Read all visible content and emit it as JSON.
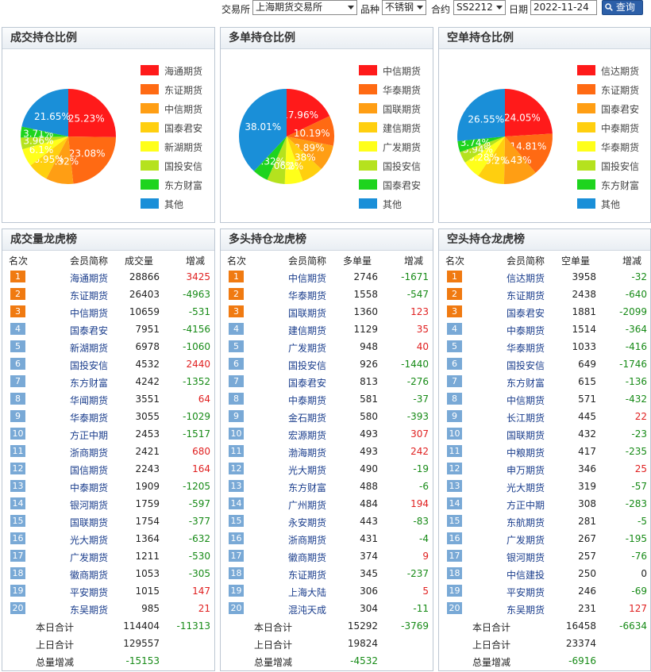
{
  "query": {
    "exchange_label": "交易所",
    "exchange_value": "上海期货交易所",
    "variety_label": "品种",
    "variety_value": "不锈钢",
    "contract_label": "合约",
    "contract_value": "SS2212",
    "date_label": "日期",
    "date_value": "2022-11-24",
    "search_label": "查询"
  },
  "pie_panels": [
    {
      "title": "成交持仓比例",
      "chart_data": {
        "type": "pie",
        "slices": [
          {
            "label": "海通期货",
            "value": 25.23,
            "color": "#ff1a1a"
          },
          {
            "label": "东证期货",
            "value": 23.08,
            "color": "#ff6a13"
          },
          {
            "label": "中信期货",
            "value": 9.32,
            "color": "#ff9e14"
          },
          {
            "label": "国泰君安",
            "value": 6.95,
            "color": "#ffcf0f"
          },
          {
            "label": "新湖期货",
            "value": 6.1,
            "color": "#ffff1a"
          },
          {
            "label": "国投安信",
            "value": 3.96,
            "color": "#b5e21e"
          },
          {
            "label": "东方财富",
            "value": 3.71,
            "color": "#1ed41e"
          },
          {
            "label": "其他",
            "value": 21.65,
            "color": "#1a8fd8"
          }
        ]
      }
    },
    {
      "title": "多单持仓比例",
      "chart_data": {
        "type": "pie",
        "slices": [
          {
            "label": "中信期货",
            "value": 17.96,
            "color": "#ff1a1a"
          },
          {
            "label": "华泰期货",
            "value": 10.19,
            "color": "#ff6a13"
          },
          {
            "label": "国联期货",
            "value": 8.89,
            "color": "#ff9e14"
          },
          {
            "label": "建信期货",
            "value": 7.38,
            "color": "#ffcf0f"
          },
          {
            "label": "广发期货",
            "value": 6.2,
            "color": "#ffff1a"
          },
          {
            "label": "国投安信",
            "value": 6.06,
            "color": "#b5e21e"
          },
          {
            "label": "国泰君安",
            "value": 5.32,
            "color": "#1ed41e"
          },
          {
            "label": "其他",
            "value": 38.01,
            "color": "#1a8fd8"
          }
        ]
      }
    },
    {
      "title": "空单持仓比例",
      "chart_data": {
        "type": "pie",
        "slices": [
          {
            "label": "信达期货",
            "value": 24.05,
            "color": "#ff1a1a"
          },
          {
            "label": "东证期货",
            "value": 14.81,
            "color": "#ff6a13"
          },
          {
            "label": "国泰君安",
            "value": 11.43,
            "color": "#ff9e14"
          },
          {
            "label": "中泰期货",
            "value": 9.2,
            "color": "#ffcf0f"
          },
          {
            "label": "华泰期货",
            "value": 6.28,
            "color": "#ffff1a"
          },
          {
            "label": "国投安信",
            "value": 3.94,
            "color": "#b5e21e"
          },
          {
            "label": "东方财富",
            "value": 3.74,
            "color": "#1ed41e"
          },
          {
            "label": "其他",
            "value": 26.55,
            "color": "#1a8fd8"
          }
        ]
      }
    }
  ],
  "tables": [
    {
      "title": "成交量龙虎榜",
      "headers": [
        "名次",
        "会员简称",
        "成交量",
        "增减"
      ],
      "rows": [
        [
          "1",
          "海通期货",
          "28866",
          "3425"
        ],
        [
          "2",
          "东证期货",
          "26403",
          "-4963"
        ],
        [
          "3",
          "中信期货",
          "10659",
          "-531"
        ],
        [
          "4",
          "国泰君安",
          "7951",
          "-4156"
        ],
        [
          "5",
          "新湖期货",
          "6978",
          "-1060"
        ],
        [
          "6",
          "国投安信",
          "4532",
          "2440"
        ],
        [
          "7",
          "东方财富",
          "4242",
          "-1352"
        ],
        [
          "8",
          "华闻期货",
          "3551",
          "64"
        ],
        [
          "9",
          "华泰期货",
          "3055",
          "-1029"
        ],
        [
          "10",
          "方正中期",
          "2453",
          "-1517"
        ],
        [
          "11",
          "浙商期货",
          "2421",
          "680"
        ],
        [
          "12",
          "国信期货",
          "2243",
          "164"
        ],
        [
          "13",
          "中泰期货",
          "1909",
          "-1205"
        ],
        [
          "14",
          "银河期货",
          "1759",
          "-597"
        ],
        [
          "15",
          "国联期货",
          "1754",
          "-377"
        ],
        [
          "16",
          "光大期货",
          "1364",
          "-632"
        ],
        [
          "17",
          "广发期货",
          "1211",
          "-530"
        ],
        [
          "18",
          "徽商期货",
          "1053",
          "-305"
        ],
        [
          "19",
          "平安期货",
          "1015",
          "147"
        ],
        [
          "20",
          "东吴期货",
          "985",
          "21"
        ]
      ],
      "summary": [
        [
          "本日合计",
          "114404",
          "-11313"
        ],
        [
          "上日合计",
          "129557",
          ""
        ],
        [
          "总量增减",
          "-15153",
          ""
        ]
      ]
    },
    {
      "title": "多头持仓龙虎榜",
      "headers": [
        "名次",
        "会员简称",
        "多单量",
        "增减"
      ],
      "rows": [
        [
          "1",
          "中信期货",
          "2746",
          "-1671"
        ],
        [
          "2",
          "华泰期货",
          "1558",
          "-547"
        ],
        [
          "3",
          "国联期货",
          "1360",
          "123"
        ],
        [
          "4",
          "建信期货",
          "1129",
          "35"
        ],
        [
          "5",
          "广发期货",
          "948",
          "40"
        ],
        [
          "6",
          "国投安信",
          "926",
          "-1440"
        ],
        [
          "7",
          "国泰君安",
          "813",
          "-276"
        ],
        [
          "8",
          "中泰期货",
          "581",
          "-37"
        ],
        [
          "9",
          "金石期货",
          "580",
          "-393"
        ],
        [
          "10",
          "宏源期货",
          "493",
          "307"
        ],
        [
          "11",
          "渤海期货",
          "493",
          "242"
        ],
        [
          "12",
          "光大期货",
          "490",
          "-19"
        ],
        [
          "13",
          "东方财富",
          "488",
          "-6"
        ],
        [
          "14",
          "广州期货",
          "484",
          "194"
        ],
        [
          "15",
          "永安期货",
          "443",
          "-83"
        ],
        [
          "16",
          "浙商期货",
          "431",
          "-4"
        ],
        [
          "17",
          "徽商期货",
          "374",
          "9"
        ],
        [
          "18",
          "东证期货",
          "345",
          "-237"
        ],
        [
          "19",
          "上海大陆",
          "306",
          "5"
        ],
        [
          "20",
          "混沌天成",
          "304",
          "-11"
        ]
      ],
      "summary": [
        [
          "本日合计",
          "15292",
          "-3769"
        ],
        [
          "上日合计",
          "19824",
          ""
        ],
        [
          "总量增减",
          "-4532",
          ""
        ]
      ]
    },
    {
      "title": "空头持仓龙虎榜",
      "headers": [
        "名次",
        "会员简称",
        "空单量",
        "增减"
      ],
      "rows": [
        [
          "1",
          "信达期货",
          "3958",
          "-32"
        ],
        [
          "2",
          "东证期货",
          "2438",
          "-640"
        ],
        [
          "3",
          "国泰君安",
          "1881",
          "-2099"
        ],
        [
          "4",
          "中泰期货",
          "1514",
          "-364"
        ],
        [
          "5",
          "华泰期货",
          "1033",
          "-416"
        ],
        [
          "6",
          "国投安信",
          "649",
          "-1746"
        ],
        [
          "7",
          "东方财富",
          "615",
          "-136"
        ],
        [
          "8",
          "中信期货",
          "571",
          "-432"
        ],
        [
          "9",
          "长江期货",
          "445",
          "22"
        ],
        [
          "10",
          "国联期货",
          "432",
          "-23"
        ],
        [
          "11",
          "中粮期货",
          "417",
          "-235"
        ],
        [
          "12",
          "申万期货",
          "346",
          "25"
        ],
        [
          "13",
          "光大期货",
          "319",
          "-57"
        ],
        [
          "14",
          "方正中期",
          "308",
          "-283"
        ],
        [
          "15",
          "东航期货",
          "281",
          "-5"
        ],
        [
          "16",
          "广发期货",
          "267",
          "-195"
        ],
        [
          "17",
          "银河期货",
          "257",
          "-76"
        ],
        [
          "18",
          "中信建投",
          "250",
          "0"
        ],
        [
          "19",
          "平安期货",
          "246",
          "-69"
        ],
        [
          "20",
          "东吴期货",
          "231",
          "127"
        ]
      ],
      "summary": [
        [
          "本日合计",
          "16458",
          "-6634"
        ],
        [
          "上日合计",
          "23374",
          ""
        ],
        [
          "总量增减",
          "-6916",
          ""
        ]
      ]
    }
  ]
}
